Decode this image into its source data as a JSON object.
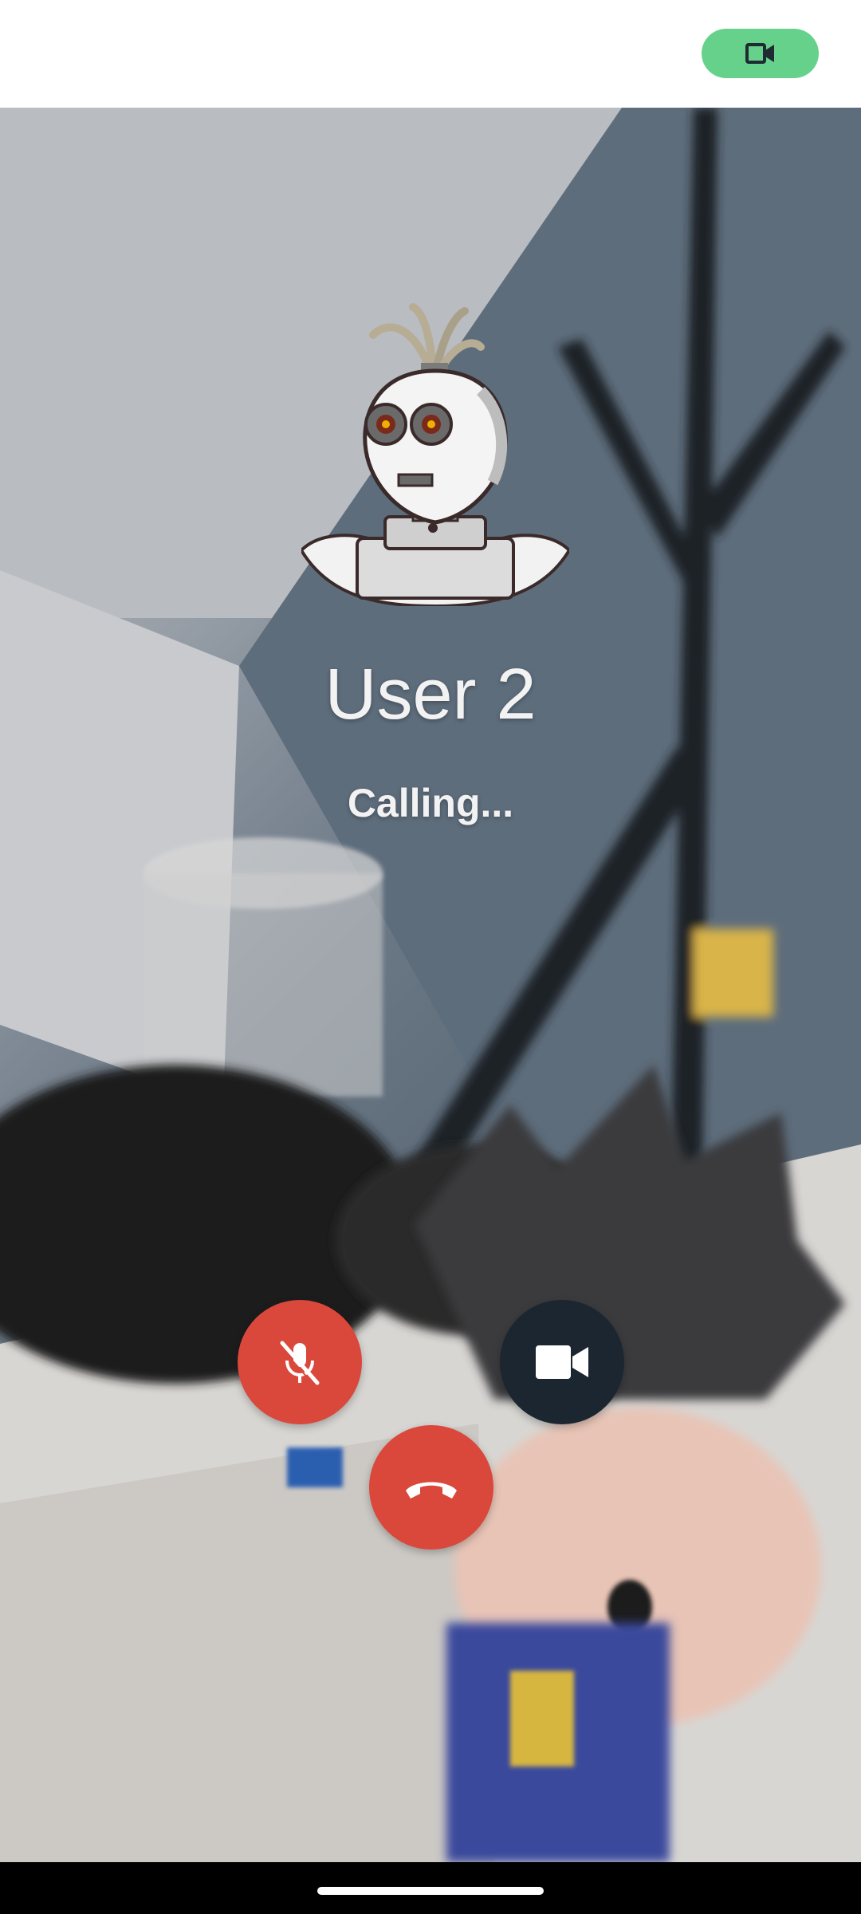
{
  "top_bar": {
    "video_chip_icon": "video-camera-icon",
    "video_chip_color": "#66d18a"
  },
  "caller": {
    "name": "User 2",
    "status": "Calling...",
    "avatar_icon": "robot-avatar"
  },
  "controls": {
    "mute": {
      "icon": "mic-off-icon",
      "color": "#d9483b"
    },
    "video": {
      "icon": "video-camera-icon",
      "color": "#1c2630"
    },
    "end_call": {
      "icon": "phone-hangup-icon",
      "color": "#d9483b"
    }
  }
}
